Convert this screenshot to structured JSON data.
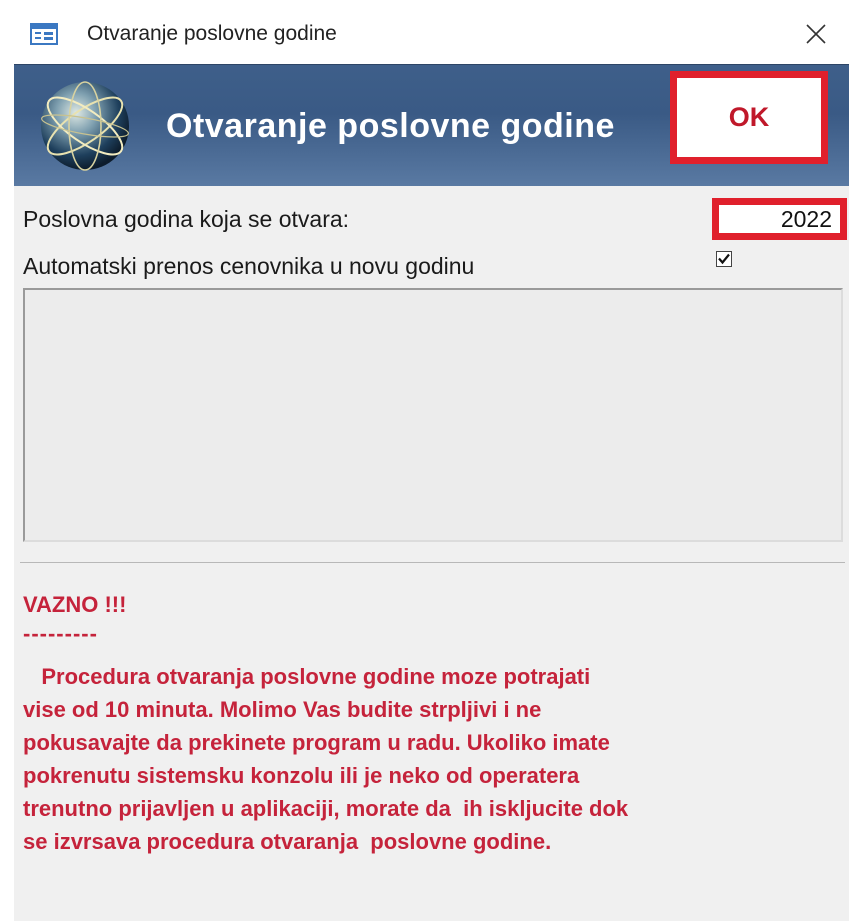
{
  "window": {
    "title": "Otvaranje poslovne godine",
    "close_icon": "close-icon"
  },
  "header": {
    "title": "Otvaranje poslovne godine",
    "ok_label": "OK",
    "logo_icon": "globe-icon"
  },
  "form": {
    "year_label": "Poslovna godina koja se otvara:",
    "year_value": "2022",
    "auto_transfer_label": "Automatski prenos cenovnika u novu godinu",
    "auto_transfer_checked": true
  },
  "notice": {
    "heading": "VAZNO !!!",
    "divider": "---------",
    "text": "   Procedura otvaranja poslovne godine moze potrajati\nvise od 10 minuta. Molimo Vas budite strpljivi i ne\npokusavajte da prekinete program u radu. Ukoliko imate\npokrenutu sistemsku konzolu ili je neko od operatera\ntrenutno prijavljen u aplikaciji, morate da  ih iskljucite dok\nse izvrsava procedura otvaranja  poslovne godine."
  },
  "colors": {
    "header_bg": "#3e5f8a",
    "highlight_red": "#e0202c",
    "warning_text": "#c5233b"
  }
}
